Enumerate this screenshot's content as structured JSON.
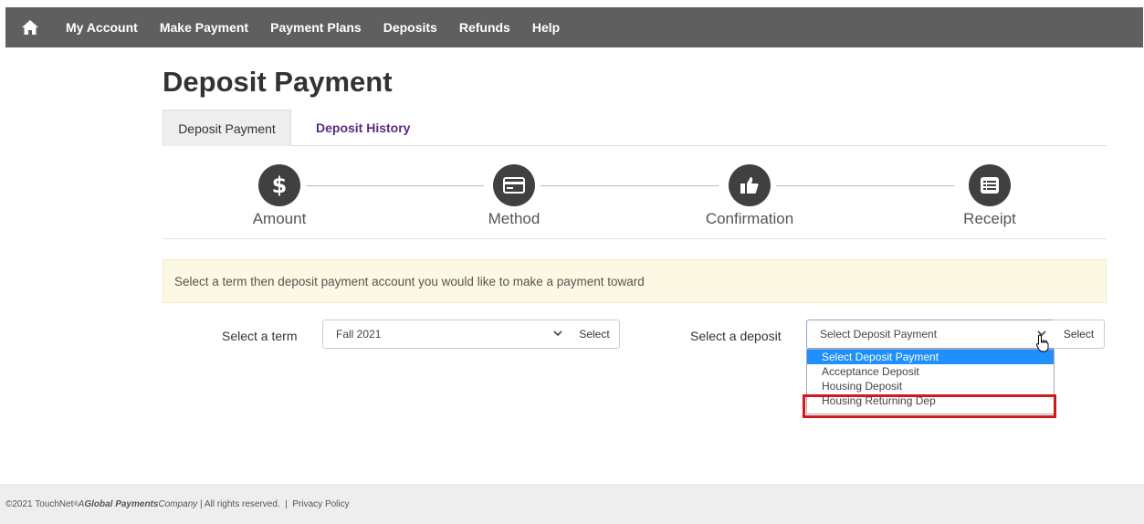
{
  "nav": {
    "items": [
      "My Account",
      "Make Payment",
      "Payment Plans",
      "Deposits",
      "Refunds",
      "Help"
    ]
  },
  "page": {
    "title": "Deposit Payment"
  },
  "tabs": [
    {
      "label": "Deposit Payment"
    },
    {
      "label": "Deposit History"
    }
  ],
  "steps": [
    {
      "label": "Amount",
      "icon": "dollar-icon"
    },
    {
      "label": "Method",
      "icon": "credit-card-icon"
    },
    {
      "label": "Confirmation",
      "icon": "thumbs-up-icon"
    },
    {
      "label": "Receipt",
      "icon": "list-icon"
    }
  ],
  "alert": {
    "text": "Select a term then deposit payment account you would like to make a payment toward"
  },
  "term": {
    "label": "Select a term",
    "value": "Fall 2021",
    "button": "Select"
  },
  "deposit": {
    "label": "Select a deposit",
    "value": "Select Deposit Payment",
    "button": "Select",
    "options": [
      "Select Deposit Payment",
      "Acceptance Deposit",
      "Housing Deposit",
      "Housing Returning Dep"
    ]
  },
  "footer": {
    "prefix": "©2021 TouchNet",
    "reg": "®",
    "a": " A ",
    "brand": "Global Payments",
    "company": " Company",
    "rights": " | All rights reserved.  |  ",
    "privacy": "Privacy Policy"
  },
  "colors": {
    "nav_bg": "#5f5f5f",
    "accent_purple": "#5a2a82",
    "alert_bg": "#fcf8e3",
    "highlight_red": "#d0181f",
    "selected_blue": "#1e90ff"
  }
}
